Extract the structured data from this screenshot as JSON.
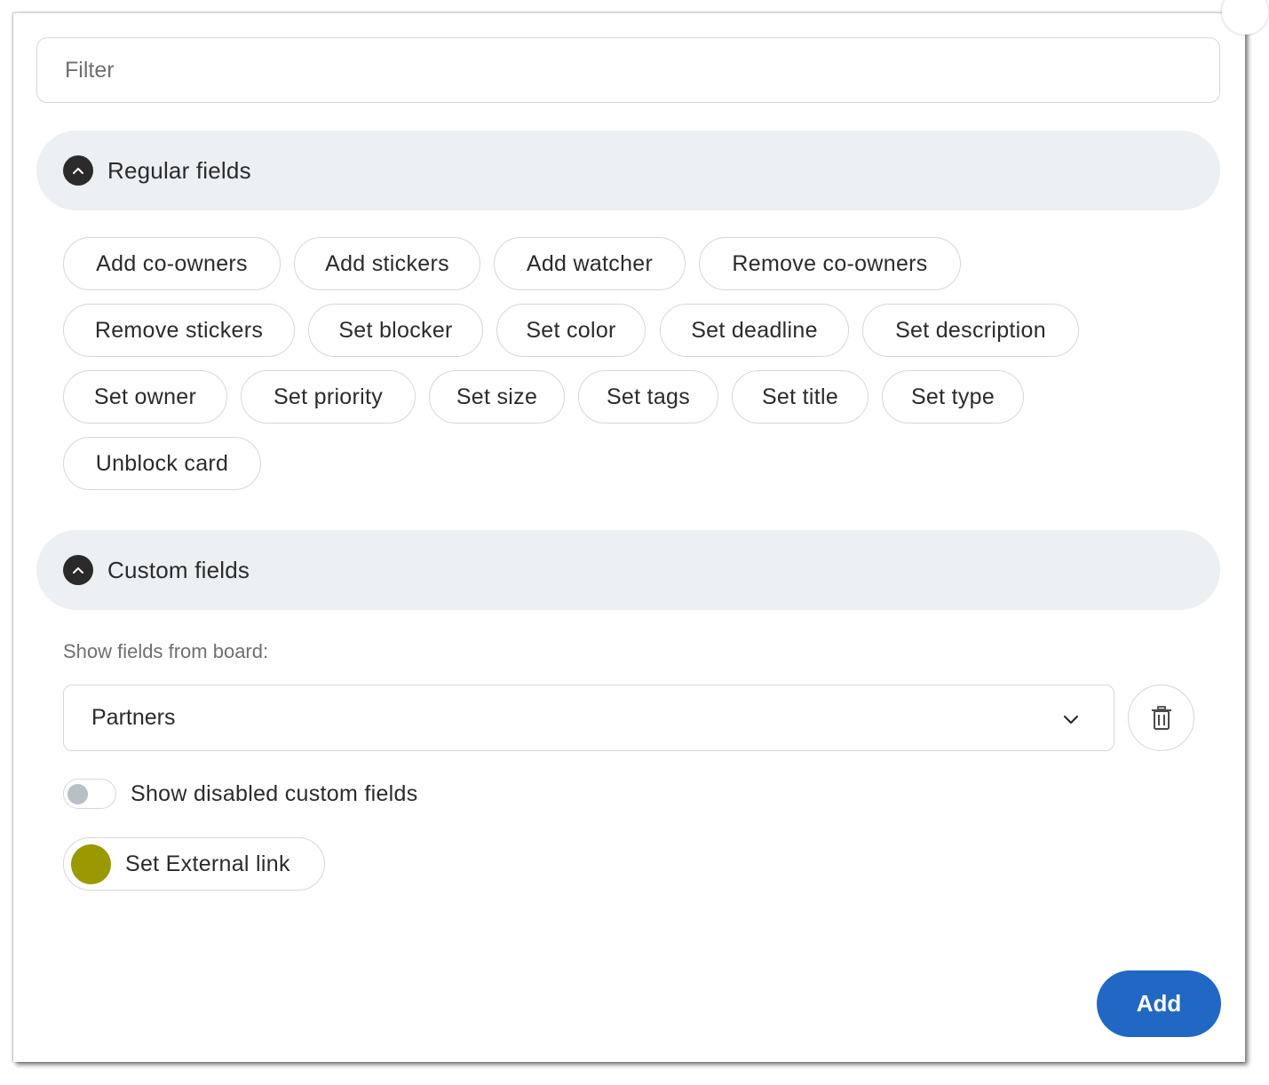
{
  "filter": {
    "placeholder": "Filter",
    "value": ""
  },
  "regular_section": {
    "title": "Regular fields",
    "chips": [
      "Add co-owners",
      "Add stickers",
      "Add watcher",
      "Remove co-owners",
      "Remove stickers",
      "Set blocker",
      "Set color",
      "Set deadline",
      "Set description",
      "Set owner",
      "Set priority",
      "Set size",
      "Set tags",
      "Set title",
      "Set type",
      "Unblock card"
    ]
  },
  "custom_section": {
    "title": "Custom fields",
    "board_label": "Show fields from board:",
    "board_selected": "Partners",
    "toggle_label": "Show disabled custom fields",
    "toggle_on": false,
    "fields": [
      {
        "label": "Set External link",
        "color": "#9a9a00"
      }
    ]
  },
  "footer": {
    "add_label": "Add"
  },
  "colors": {
    "accent": "#2167c4",
    "section_bg": "#edf0f2",
    "chevron_bg": "#2a2a2a"
  }
}
